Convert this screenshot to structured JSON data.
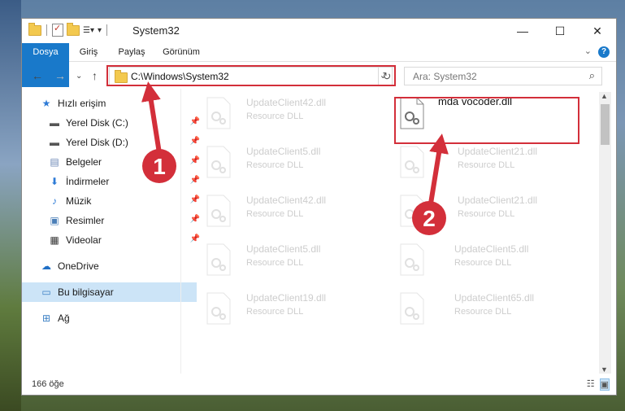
{
  "window": {
    "title": "System32"
  },
  "window_controls": {
    "minimize": "—",
    "maximize": "☐",
    "close": "✕"
  },
  "ribbon": {
    "tabs": [
      "Dosya",
      "Giriş",
      "Paylaş",
      "Görünüm"
    ],
    "help": "?"
  },
  "address": {
    "path": "C:\\Windows\\System32"
  },
  "search": {
    "placeholder": "Ara: System32"
  },
  "sidebar": {
    "items": [
      {
        "label": "Hızlı erişim",
        "icon": "star-icon"
      },
      {
        "label": "Yerel Disk (C:)",
        "icon": "drive-icon",
        "pinned": true
      },
      {
        "label": "Yerel Disk (D:)",
        "icon": "drive-icon",
        "pinned": true
      },
      {
        "label": "Belgeler",
        "icon": "documents-icon",
        "pinned": true
      },
      {
        "label": "İndirmeler",
        "icon": "download-icon",
        "pinned": true
      },
      {
        "label": "Müzik",
        "icon": "music-icon",
        "pinned": true
      },
      {
        "label": "Resimler",
        "icon": "pictures-icon",
        "pinned": true
      },
      {
        "label": "Videolar",
        "icon": "video-icon",
        "pinned": true
      },
      {
        "label": "OneDrive",
        "icon": "cloud-icon"
      },
      {
        "label": "Bu bilgisayar",
        "icon": "computer-icon",
        "selected": true
      },
      {
        "label": "Ağ",
        "icon": "network-icon"
      }
    ]
  },
  "files": [
    {
      "name": "UpdateClient42.dll",
      "type": "Resource DLL"
    },
    {
      "name": "mda vocoder.dll",
      "type": ""
    },
    {
      "name": "UpdateClient5.dll",
      "type": "Resource DLL"
    },
    {
      "name": "UpdateClient21.dll",
      "type": "Resource DLL"
    },
    {
      "name": "UpdateClient42.dll",
      "type": "Resource DLL"
    },
    {
      "name": "UpdateClient21.dll",
      "type": "Resource DLL"
    },
    {
      "name": "UpdateClient5.dll",
      "type": "Resource DLL"
    },
    {
      "name": "UpdateClient5.dll",
      "type": "Resource DLL"
    },
    {
      "name": "UpdateClient19.dll",
      "type": "Resource DLL"
    },
    {
      "name": "UpdateClient65.dll",
      "type": "Resource DLL"
    }
  ],
  "status": {
    "count": "166 öğe"
  },
  "annotations": {
    "step1": "1",
    "step2": "2",
    "color": "#d32f3a"
  }
}
